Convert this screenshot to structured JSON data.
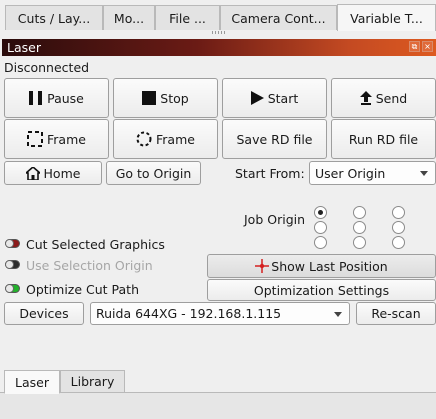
{
  "tabs": [
    "Cuts / Lay...",
    "Mo...",
    "File ...",
    "Camera Cont...",
    "Variable T..."
  ],
  "panel": {
    "title": "Laser",
    "status": "Disconnected"
  },
  "buttons": {
    "pause": "Pause",
    "stop": "Stop",
    "start": "Start",
    "send": "Send",
    "frame_rect": "Frame",
    "frame_circle": "Frame",
    "save_rd": "Save RD file",
    "run_rd": "Run RD file",
    "home": "Home",
    "go_to_origin": "Go to Origin",
    "show_last_position": "Show Last Position",
    "optimization_settings": "Optimization Settings",
    "devices": "Devices",
    "rescan": "Re-scan"
  },
  "start_from": {
    "label": "Start From:",
    "value": "User Origin"
  },
  "job_origin": {
    "label": "Job Origin",
    "selected_index": 0
  },
  "options": {
    "cut_selected": "Cut Selected Graphics",
    "use_selection_origin": "Use Selection Origin",
    "optimize_cut_path": "Optimize Cut Path"
  },
  "device": {
    "value": "Ruida 644XG - 192.168.1.115"
  },
  "bottom_tabs": [
    "Laser",
    "Library"
  ],
  "colors": {
    "toggle_red": "#8b1a1a",
    "toggle_dark": "#2d2d2d",
    "toggle_green": "#22b22b",
    "crosshair_red": "#d42020"
  }
}
